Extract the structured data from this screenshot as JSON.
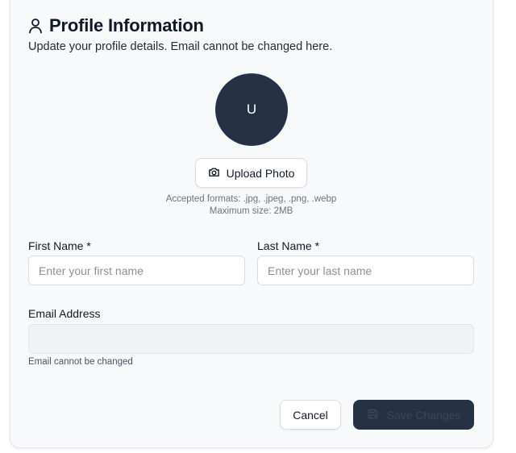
{
  "header": {
    "title": "Profile Information",
    "subtitle": "Update your profile details. Email cannot be changed here.",
    "icon": "user-icon"
  },
  "avatar": {
    "initial": "U",
    "color": "#243244"
  },
  "upload": {
    "label": "Upload Photo",
    "icon": "camera-icon",
    "formats_hint": "Accepted formats: .jpg, .jpeg, .png, .webp",
    "size_hint": "Maximum size: 2MB"
  },
  "form": {
    "first_name": {
      "label": "First Name *",
      "placeholder": "Enter your first name",
      "value": ""
    },
    "last_name": {
      "label": "Last Name *",
      "placeholder": "Enter your last name",
      "value": ""
    },
    "email": {
      "label": "Email Address",
      "value": "",
      "note": "Email cannot be changed",
      "disabled": true
    }
  },
  "actions": {
    "cancel_label": "Cancel",
    "save_label": "Save Changes",
    "save_icon": "save-icon",
    "save_disabled": true
  },
  "colors": {
    "primary": "#243244",
    "card_bg": "#f8f9fb",
    "border": "#d9dde3"
  }
}
